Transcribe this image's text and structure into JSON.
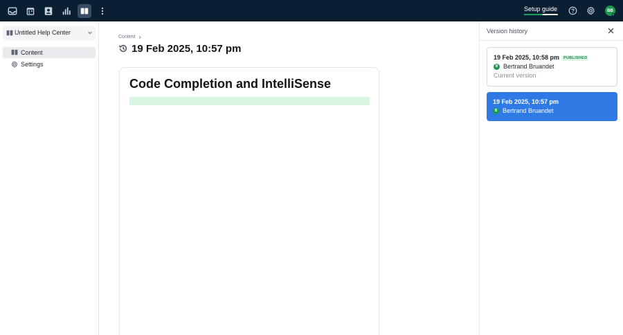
{
  "topbar": {
    "setup_guide": "Setup guide",
    "setup_progress": 0.55,
    "avatar_initials": "BB",
    "icons": [
      "inbox-icon",
      "calendar-icon",
      "contacts-icon",
      "reports-icon",
      "knowledge-icon",
      "more-vertical-icon"
    ]
  },
  "sidebar": {
    "help_center": "Untitled Help Center",
    "items": [
      {
        "label": "Content",
        "icon": "book-icon",
        "active": true
      },
      {
        "label": "Settings",
        "icon": "gear-icon",
        "active": false
      }
    ]
  },
  "main": {
    "breadcrumb": "Content",
    "title": "19 Feb 2025, 10:57 pm",
    "doc_heading": "Code Completion and IntelliSense"
  },
  "version_history": {
    "title": "Version history",
    "versions": [
      {
        "date": "19 Feb 2025, 10:58 pm",
        "badge": "PUBLISHED",
        "author_initial": "B",
        "author": "Bertrand Bruandet",
        "subtitle": "Current version",
        "selected": false
      },
      {
        "date": "19 Feb 2025, 10:57 pm",
        "author_initial": "B",
        "author": "Bertrand Bruandet",
        "selected": true
      }
    ]
  },
  "colors": {
    "topbar_bg": "#0b1f33",
    "accent_blue": "#2f7ae5",
    "brand_green": "#1a9b4b",
    "diff_added": "#d9f5e3"
  }
}
